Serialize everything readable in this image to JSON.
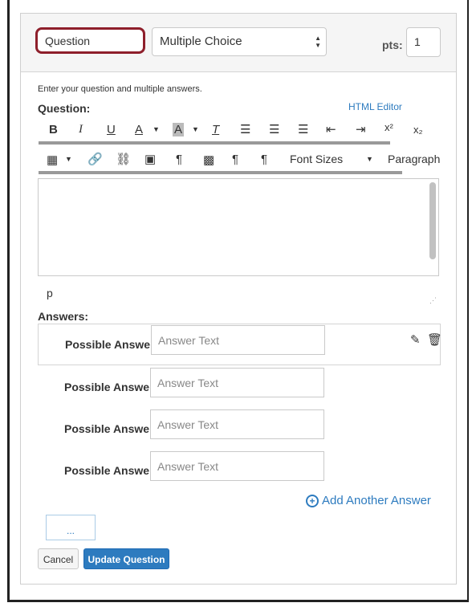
{
  "header": {
    "question_name": "Question",
    "question_type": "Multiple Choice",
    "pts_label": "pts:",
    "pts_value": "1"
  },
  "editor": {
    "instructions": "Enter your question and multiple answers.",
    "question_label": "Question:",
    "html_editor_link": "HTML Editor",
    "toolbar_row1": [
      "B",
      "I",
      "U",
      "A",
      "A",
      "T",
      "align-left",
      "align-center",
      "align-right",
      "outdent",
      "indent",
      "x²",
      "x₂"
    ],
    "toolbar_row2": {
      "font_sizes": "Font Sizes",
      "paragraph": "Paragraph"
    },
    "path": "p"
  },
  "answers": {
    "label": "Answers:",
    "items": [
      {
        "label": "Possible Answer",
        "placeholder": "Answer Text"
      },
      {
        "label": "Possible Answer",
        "placeholder": "Answer Text"
      },
      {
        "label": "Possible Answer",
        "placeholder": "Answer Text"
      },
      {
        "label": "Possible Answer",
        "placeholder": "Answer Text"
      }
    ],
    "add_label": "Add Another Answer"
  },
  "more_label": "...",
  "buttons": {
    "cancel": "Cancel",
    "update": "Update Question"
  },
  "colors": {
    "accent": "#2d7bbf",
    "highlight": "#8e1f2b"
  }
}
